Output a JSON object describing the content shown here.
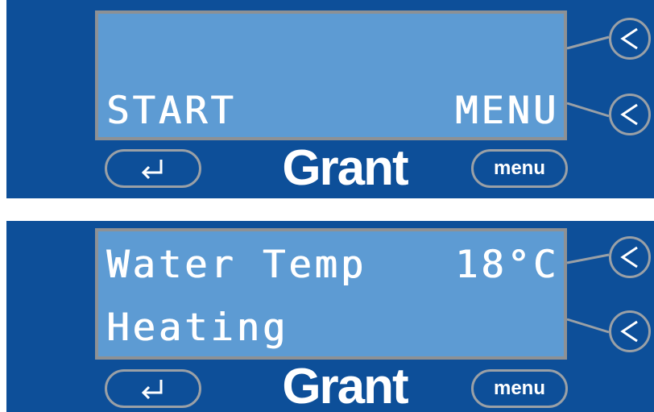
{
  "colors": {
    "panel_blue": "#0d4f99",
    "lcd_blue": "#5d9bd3",
    "lcd_border": "#8d9195",
    "button_border": "#9aa0a6",
    "text": "#ffffff"
  },
  "panels": [
    {
      "lcd": {
        "line1_left": "",
        "line1_right": "",
        "line2_left": "START",
        "line2_right": "MENU"
      },
      "side_buttons": [
        {
          "label": "<",
          "icon": "chevron-left-icon"
        },
        {
          "label": "<",
          "icon": "chevron-left-icon"
        }
      ],
      "enter_button": {
        "icon": "enter-return-icon"
      },
      "logo": "Grant",
      "menu_button": "menu"
    },
    {
      "lcd": {
        "line1_left": "Water Temp",
        "line1_right": "18°C",
        "line2_left": "Heating",
        "line2_right": ""
      },
      "side_buttons": [
        {
          "label": "<",
          "icon": "chevron-left-icon"
        },
        {
          "label": "<",
          "icon": "chevron-left-icon"
        }
      ],
      "enter_button": {
        "icon": "enter-return-icon"
      },
      "logo": "Grant",
      "menu_button": "menu"
    }
  ]
}
